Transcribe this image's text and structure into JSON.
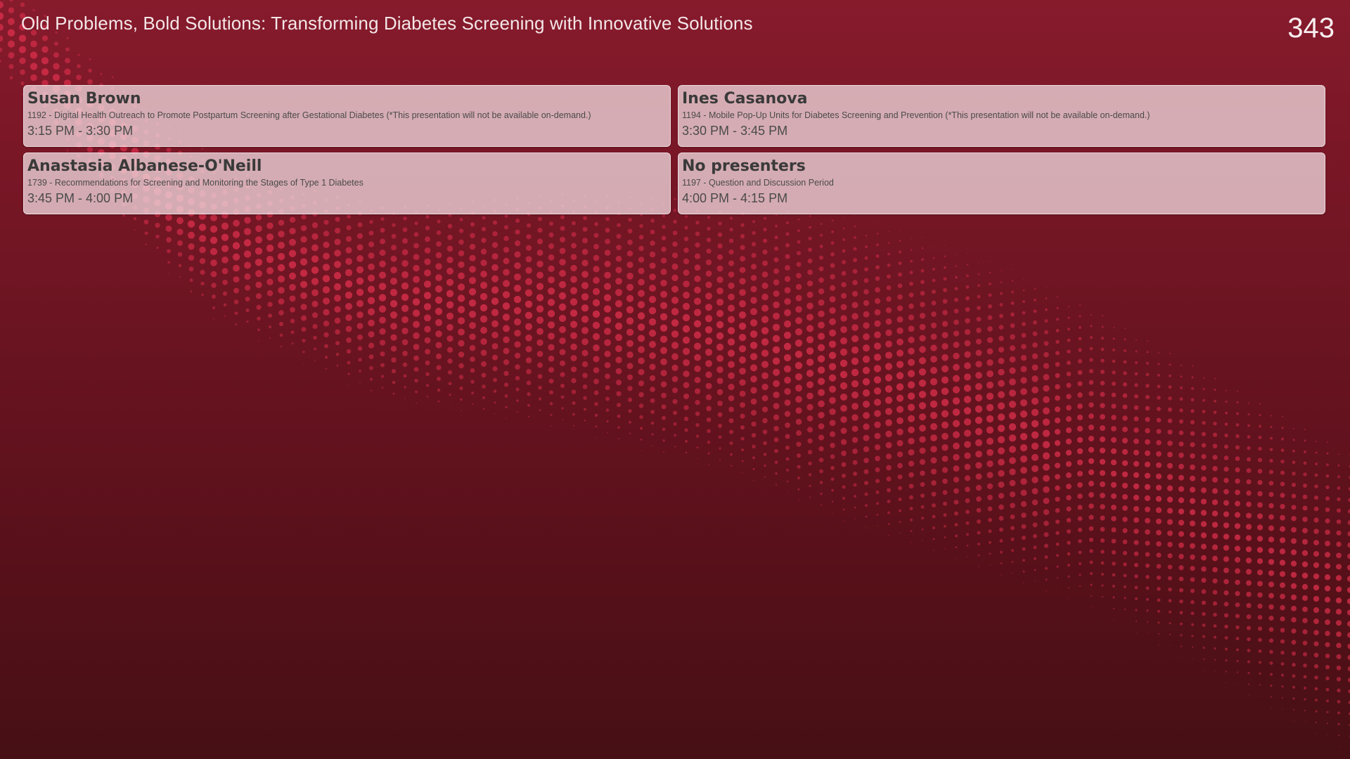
{
  "header": {
    "title": "Old Problems, Bold Solutions: Transforming Diabetes Screening with Innovative Solutions",
    "room": "343"
  },
  "colors": {
    "background_top": "#861b2c",
    "background_bottom": "#461014",
    "dot_accent": "#e0304e",
    "card_background": "#eed6db",
    "card_text": "#3a3a3a"
  },
  "sessions": [
    {
      "presenter": "Susan Brown",
      "session": "1192 - Digital Health Outreach to Promote Postpartum Screening after Gestational Diabetes (*This presentation will not be available on-demand.)",
      "time": "3:15 PM - 3:30 PM"
    },
    {
      "presenter": "Ines Casanova",
      "session": "1194 - Mobile Pop-Up Units for Diabetes Screening and Prevention (*This presentation will not be available on-demand.)",
      "time": "3:30 PM - 3:45 PM"
    },
    {
      "presenter": "Anastasia Albanese-O'Neill",
      "session": "1739 - Recommendations for Screening and Monitoring the Stages of Type 1 Diabetes",
      "time": "3:45 PM - 4:00 PM"
    },
    {
      "presenter": "No presenters",
      "session": "1197 - Question and Discussion Period",
      "time": "4:00 PM - 4:15 PM"
    }
  ]
}
